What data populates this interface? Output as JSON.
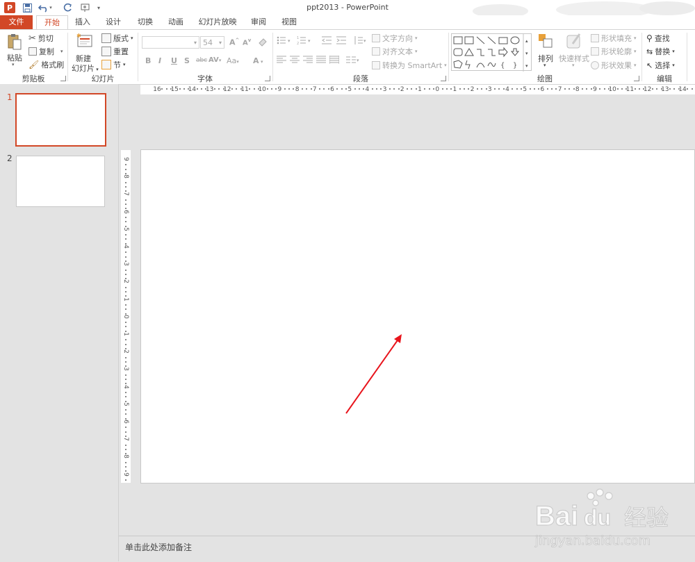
{
  "window": {
    "title": "ppt2013 - PowerPoint",
    "help": "?",
    "minimize": "—"
  },
  "tabs": [
    {
      "label": "文件"
    },
    {
      "label": "开始"
    },
    {
      "label": "插入"
    },
    {
      "label": "设计"
    },
    {
      "label": "切换"
    },
    {
      "label": "动画"
    },
    {
      "label": "幻灯片放映"
    },
    {
      "label": "审阅"
    },
    {
      "label": "视图"
    }
  ],
  "ribbon": {
    "clipboard": {
      "paste": "粘贴",
      "cut": "剪切",
      "copy": "复制",
      "format_painter": "格式刷",
      "group": "剪贴板"
    },
    "slides": {
      "new_slide_line1": "新建",
      "new_slide_line2": "幻灯片",
      "layout": "版式",
      "reset": "重置",
      "section": "节",
      "group": "幻灯片"
    },
    "font": {
      "font_name": "",
      "font_size": "54",
      "bold": "B",
      "italic": "I",
      "underline": "U",
      "shadow": "S",
      "strike": "abc",
      "spacing": "AV",
      "change_case": "Aa",
      "font_color": "A",
      "grow": "A",
      "shrink": "A",
      "group": "字体"
    },
    "paragraph": {
      "text_direction": "文字方向",
      "align_text": "对齐文本",
      "smartart": "转换为 SmartArt",
      "group": "段落"
    },
    "drawing": {
      "arrange": "排列",
      "quick_styles": "快速样式",
      "shape_fill": "形状填充",
      "shape_outline": "形状轮廓",
      "shape_effects": "形状效果",
      "group": "绘图"
    },
    "editing": {
      "find": "查找",
      "replace": "替换",
      "select": "选择",
      "group": "编辑"
    }
  },
  "slides_panel": {
    "slides": [
      {
        "number": "1",
        "selected": true
      },
      {
        "number": "2",
        "selected": false
      }
    ]
  },
  "rulers": {
    "horizontal": [
      "16",
      "15",
      "14",
      "13",
      "12",
      "11",
      "10",
      "9",
      "8",
      "7",
      "6",
      "5",
      "4",
      "3",
      "2",
      "1",
      "0",
      "1",
      "2",
      "3",
      "4",
      "5",
      "6",
      "7",
      "8",
      "9",
      "10",
      "11",
      "12",
      "13",
      "14",
      "15"
    ],
    "vertical": [
      "9",
      "8",
      "7",
      "6",
      "5",
      "4",
      "3",
      "2",
      "1",
      "0",
      "1",
      "2",
      "3",
      "4",
      "5",
      "6",
      "7",
      "8",
      "9"
    ]
  },
  "notes": {
    "placeholder": "单击此处添加备注"
  },
  "watermark": {
    "brand": "Bai",
    "brand2": "du",
    "product": "经验",
    "url": "jingyan.baidu.com"
  },
  "colors": {
    "accent": "#d24726",
    "annotation_arrow": "#e8141c"
  }
}
